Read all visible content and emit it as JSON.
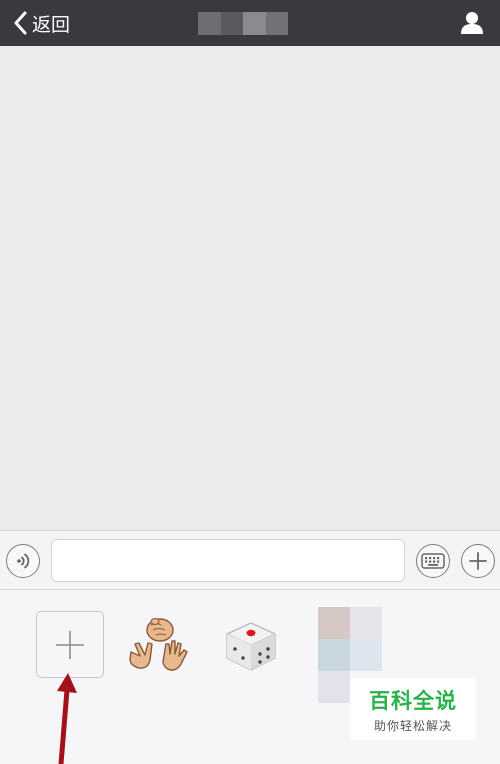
{
  "navbar": {
    "back_label": "返回",
    "title": "",
    "background": "#393a3f"
  },
  "icons": {
    "back": "chevron-left-icon",
    "profile": "person-icon",
    "voice": "voice-icon",
    "keyboard": "keyboard-icon",
    "plus": "plus-icon",
    "add_sticker": "plus-icon",
    "rps": "rock-paper-scissors-sticker",
    "dice": "dice-sticker"
  },
  "input_bar": {
    "value": "",
    "placeholder": ""
  },
  "sticker_panel": {
    "items": [
      "add-sticker",
      "rock-paper-scissors",
      "dice",
      "custom-sticker"
    ]
  },
  "watermark": {
    "title": "百科全说",
    "subtitle": "助你轻松解决",
    "color": "#29b24a"
  },
  "colors": {
    "chat_background": "#ebebeb",
    "panel_background": "#f6f6f8",
    "annotation_arrow": "#a3121a",
    "dice_pip": "#e0141b"
  }
}
